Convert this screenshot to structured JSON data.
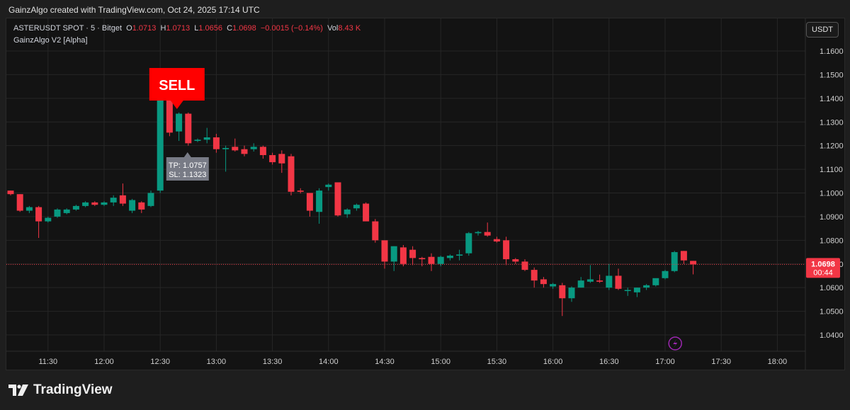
{
  "caption": "GainzAlgo created with TradingView.com, Oct 24, 2025 17:14 UTC",
  "legend": {
    "symbol": "ASTERUSDT SPOT · 5 · Bitget",
    "o_label": "O",
    "o_value": "1.0713",
    "h_label": "H",
    "h_value": "1.0713",
    "l_label": "L",
    "l_value": "1.0656",
    "c_label": "C",
    "c_value": "1.0698",
    "change": "−0.0015 (−0.14%)",
    "vol_label": "Vol",
    "vol_value": "8.43 K",
    "indicator": "GainzAlgo V2 [Alpha]"
  },
  "currency": "USDT",
  "brand": "TradingView",
  "colors": {
    "up": "#089981",
    "down": "#f23645",
    "background": "#131313",
    "signal": "#ff0000"
  },
  "chart_data": {
    "type": "candlestick",
    "ylim": [
      1.034,
      1.168
    ],
    "yticks": [
      "1.0400",
      "1.0500",
      "1.0600",
      "1.0700",
      "1.0800",
      "1.0900",
      "1.1000",
      "1.1100",
      "1.1200",
      "1.1300",
      "1.1400",
      "1.1500",
      "1.1600"
    ],
    "xticks": [
      {
        "label": "11:30",
        "slot": 4
      },
      {
        "label": "12:00",
        "slot": 10
      },
      {
        "label": "12:30",
        "slot": 16
      },
      {
        "label": "13:00",
        "slot": 22
      },
      {
        "label": "13:30",
        "slot": 28
      },
      {
        "label": "14:00",
        "slot": 34
      },
      {
        "label": "14:30",
        "slot": 40
      },
      {
        "label": "15:00",
        "slot": 46
      },
      {
        "label": "15:30",
        "slot": 52
      },
      {
        "label": "16:00",
        "slot": 58
      },
      {
        "label": "16:30",
        "slot": 64
      },
      {
        "label": "17:00",
        "slot": 70
      },
      {
        "label": "17:30",
        "slot": 76
      },
      {
        "label": "18:00",
        "slot": 82
      }
    ],
    "candles": [
      [
        1.101,
        1.101,
        1.099,
        1.0995
      ],
      [
        1.0995,
        1.0995,
        1.092,
        1.0925
      ],
      [
        1.0925,
        1.0945,
        1.0915,
        1.094
      ],
      [
        1.094,
        1.0945,
        1.081,
        1.088
      ],
      [
        1.088,
        1.09,
        1.0875,
        1.0895
      ],
      [
        1.09,
        1.0935,
        1.0895,
        1.093
      ],
      [
        1.0915,
        1.0935,
        1.091,
        1.093
      ],
      [
        1.093,
        1.095,
        1.0925,
        1.0945
      ],
      [
        1.0945,
        1.0965,
        1.094,
        1.096
      ],
      [
        1.096,
        1.0965,
        1.0945,
        1.095
      ],
      [
        1.095,
        1.0965,
        1.0945,
        1.096
      ],
      [
        1.096,
        1.099,
        1.0945,
        1.098
      ],
      [
        1.099,
        1.104,
        1.0945,
        1.0955
      ],
      [
        1.0925,
        1.0975,
        1.0915,
        1.097
      ],
      [
        1.096,
        1.0965,
        1.0915,
        1.093
      ],
      [
        1.0945,
        1.101,
        1.094,
        1.1
      ],
      [
        1.101,
        1.14,
        1.1,
        1.1395
      ],
      [
        1.1395,
        1.14,
        1.124,
        1.1255
      ],
      [
        1.126,
        1.134,
        1.122,
        1.1335
      ],
      [
        1.1335,
        1.134,
        1.12,
        1.121
      ],
      [
        1.122,
        1.123,
        1.1215,
        1.1225
      ],
      [
        1.1225,
        1.1275,
        1.121,
        1.1235
      ],
      [
        1.1235,
        1.125,
        1.117,
        1.1185
      ],
      [
        1.1185,
        1.12,
        1.109,
        1.119
      ],
      [
        1.1195,
        1.123,
        1.1175,
        1.118
      ],
      [
        1.1185,
        1.12,
        1.1155,
        1.1165
      ],
      [
        1.1185,
        1.121,
        1.1175,
        1.1195
      ],
      [
        1.1195,
        1.12,
        1.1145,
        1.116
      ],
      [
        1.116,
        1.117,
        1.112,
        1.113
      ],
      [
        1.1165,
        1.118,
        1.1085,
        1.1125
      ],
      [
        1.1155,
        1.1165,
        1.099,
        1.1005
      ],
      [
        1.101,
        1.102,
        1.0998,
        1.1005
      ],
      [
        1.1,
        1.1,
        1.09,
        1.0925
      ],
      [
        1.092,
        1.102,
        1.087,
        1.101
      ],
      [
        1.1025,
        1.104,
        1.101,
        1.1035
      ],
      [
        1.1045,
        1.1045,
        1.09,
        1.0905
      ],
      [
        1.091,
        1.0935,
        1.0895,
        1.093
      ],
      [
        1.0935,
        1.0955,
        1.0925,
        1.095
      ],
      [
        1.0955,
        1.096,
        1.094,
        1.088
      ],
      [
        1.088,
        1.089,
        1.079,
        1.08
      ],
      [
        1.08,
        1.08,
        1.068,
        1.071
      ],
      [
        1.071,
        1.0775,
        1.067,
        1.0775
      ],
      [
        1.077,
        1.078,
        1.069,
        1.07
      ],
      [
        1.076,
        1.0775,
        1.0695,
        1.0725
      ],
      [
        1.0725,
        1.073,
        1.069,
        1.072
      ],
      [
        1.073,
        1.0745,
        1.067,
        1.07
      ],
      [
        1.07,
        1.0735,
        1.069,
        1.073
      ],
      [
        1.0725,
        1.074,
        1.0715,
        1.0735
      ],
      [
        1.0735,
        1.076,
        1.0715,
        1.074
      ],
      [
        1.0745,
        1.0835,
        1.0735,
        1.083
      ],
      [
        1.083,
        1.084,
        1.082,
        1.0835
      ],
      [
        1.0835,
        1.0875,
        1.0815,
        1.082
      ],
      [
        1.0805,
        1.0815,
        1.079,
        1.0795
      ],
      [
        1.08,
        1.0815,
        1.0695,
        1.072
      ],
      [
        1.072,
        1.0725,
        1.07,
        1.071
      ],
      [
        1.071,
        1.072,
        1.067,
        1.0675
      ],
      [
        1.0675,
        1.0685,
        1.06,
        1.063
      ],
      [
        1.0635,
        1.0645,
        1.06,
        1.0615
      ],
      [
        1.0605,
        1.062,
        1.0595,
        1.0615
      ],
      [
        1.061,
        1.062,
        1.048,
        1.0555
      ],
      [
        1.0555,
        1.0605,
        1.054,
        1.06
      ],
      [
        1.06,
        1.0645,
        1.06,
        1.063
      ],
      [
        1.0625,
        1.0695,
        1.062,
        1.0635
      ],
      [
        1.063,
        1.0655,
        1.062,
        1.0625
      ],
      [
        1.06,
        1.07,
        1.059,
        1.065
      ],
      [
        1.065,
        1.068,
        1.059,
        1.0595
      ],
      [
        1.059,
        1.06,
        1.0565,
        1.059
      ],
      [
        1.058,
        1.06,
        1.056,
        1.06
      ],
      [
        1.06,
        1.0615,
        1.059,
        1.061
      ],
      [
        1.061,
        1.0635,
        1.0605,
        1.064
      ],
      [
        1.064,
        1.0675,
        1.0635,
        1.067
      ],
      [
        1.067,
        1.0755,
        1.0665,
        1.075
      ],
      [
        1.0755,
        1.0755,
        1.07,
        1.0715
      ],
      [
        1.0713,
        1.0713,
        1.0656,
        1.0698
      ]
    ],
    "current_price": "1.0698",
    "countdown": "00:44",
    "signal": {
      "label": "SELL",
      "slot": 19
    },
    "tp_label": "TP: 1.0757",
    "sl_label": "SL: 1.1323",
    "marker_icon": "lightning-icon"
  }
}
